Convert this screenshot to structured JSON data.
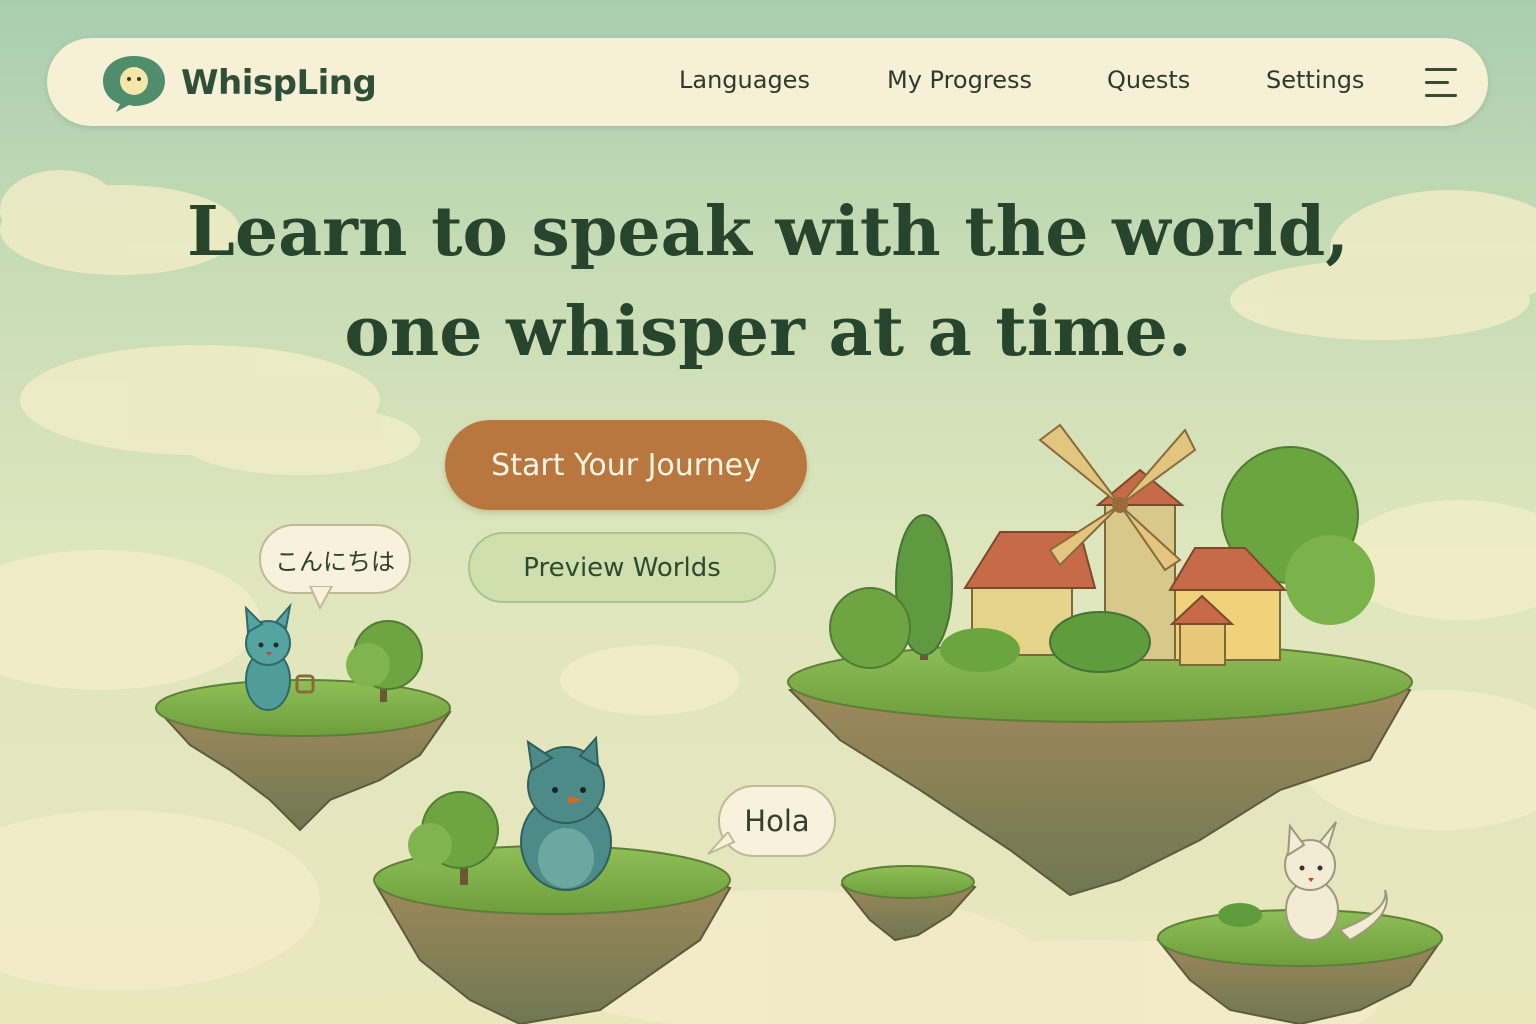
{
  "app": {
    "brand": "WhispLing"
  },
  "nav": {
    "items": [
      {
        "label": "Languages"
      },
      {
        "label": "My Progress"
      },
      {
        "label": "Quests"
      },
      {
        "label": "Settings"
      }
    ],
    "menu_icon": "hamburger-menu-icon"
  },
  "hero": {
    "headline_line1": "Learn to speak with the world,",
    "headline_line2": "one whisper at a time.",
    "primary_cta": "Start Your Journey",
    "secondary_cta": "Preview Worlds"
  },
  "speech_bubbles": {
    "japanese": "こんにちは",
    "spanish": "Hola"
  },
  "icons": [
    "speech-bubble-logo-icon",
    "hamburger-menu-icon"
  ],
  "colors": {
    "primary_button": "#b9773f",
    "secondary_button": "#cfe0ae",
    "headline": "#27442c",
    "navbar": "#f6f0d6"
  }
}
